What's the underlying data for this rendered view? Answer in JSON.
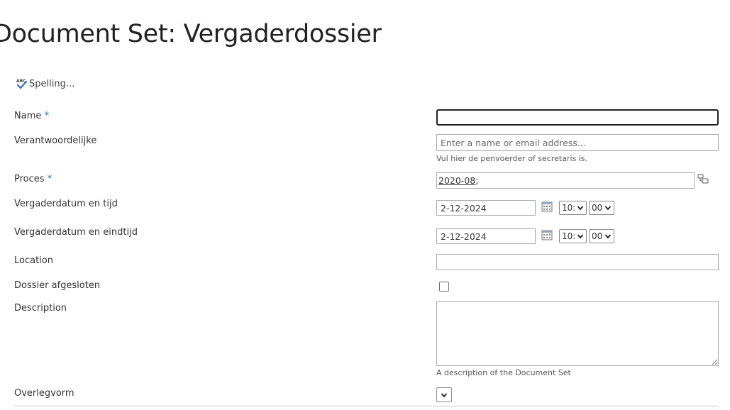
{
  "page": {
    "title": "Document Set: Vergaderdossier"
  },
  "toolbar": {
    "spelling_label": "Spelling..."
  },
  "fields": {
    "name": {
      "label": "Name",
      "required_mark": "*",
      "value": ""
    },
    "verantwoordelijke": {
      "label": "Verantwoordelijke",
      "placeholder": "Enter a name or email address...",
      "hint": "Vul hier de penvoerder of secretaris is."
    },
    "proces": {
      "label": "Proces",
      "required_mark": "*",
      "value": "2020-08",
      "separator": ";"
    },
    "vergaderdatum_tijd": {
      "label": "Vergaderdatum en tijd",
      "date": "2-12-2024",
      "hour": "10:",
      "minute": "00"
    },
    "vergaderdatum_eindtijd": {
      "label": "Vergaderdatum en eindtijd",
      "date": "2-12-2024",
      "hour": "10:",
      "minute": "00"
    },
    "location": {
      "label": "Location",
      "value": ""
    },
    "dossier_afgesloten": {
      "label": "Dossier afgesloten",
      "checked": false
    },
    "description": {
      "label": "Description",
      "value": "",
      "hint": "A description of the Document Set"
    },
    "overlegvorm": {
      "label": "Overlegvorm",
      "value": ""
    }
  },
  "icons": {
    "spelling": "abc-check-icon",
    "calendar": "calendar-icon",
    "lookup": "browse-lookup-icon",
    "dropdown": "chevron-down-icon"
  },
  "colors": {
    "required": "#2e6bb0",
    "border": "#ababab",
    "focus_border": "#222222"
  }
}
